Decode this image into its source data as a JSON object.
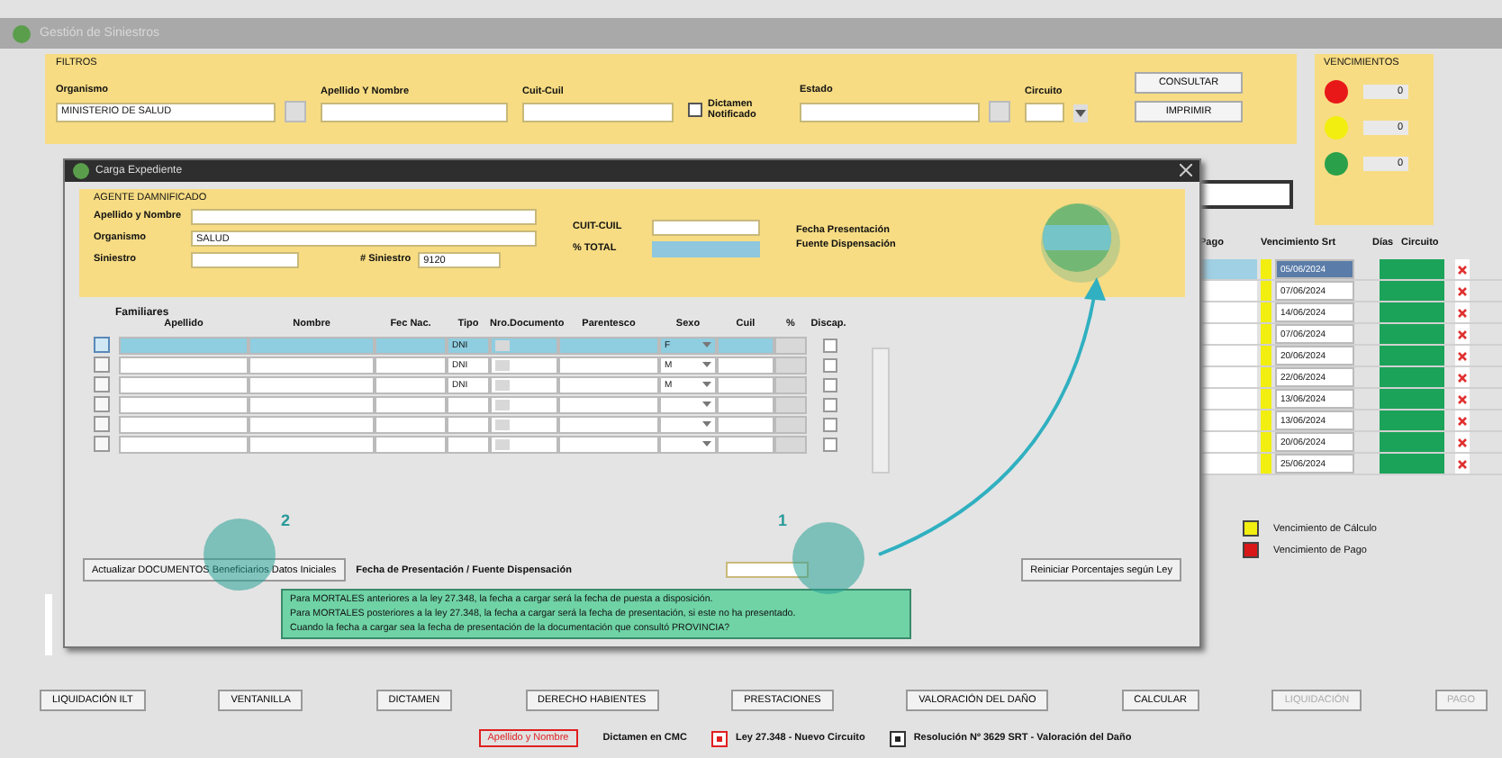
{
  "window": {
    "title": "Gestión de Siniestros"
  },
  "filters": {
    "title": "FILTROS",
    "fields": [
      {
        "label": "Organismo",
        "value": "MINISTERIO DE SALUD",
        "kind": "lookup"
      },
      {
        "label": "Apellido Y Nombre",
        "kind": "text"
      },
      {
        "label": "Cuit-Cuil",
        "kind": "text"
      },
      {
        "label": "Dictamen Notificado",
        "kind": "checkbox",
        "checked": false
      },
      {
        "label": "Estado",
        "kind": "lookup"
      },
      {
        "label": "Circuito",
        "kind": "select"
      }
    ],
    "buttons": [
      "CONSULTAR",
      "IMPRIMIR"
    ]
  },
  "vencimientos": {
    "title": "VENCIMIENTOS",
    "lights": [
      {
        "color": "#e81818",
        "count": "0"
      },
      {
        "color": "#f2ee10",
        "count": "0"
      },
      {
        "color": "#2aa04a",
        "count": "0"
      }
    ]
  },
  "expedientes": {
    "columns": [
      "Pago",
      "Vencimiento Srt",
      "Días",
      "Circuito"
    ],
    "rows": [
      {
        "vencimiento": "05/06/2024",
        "selected": true
      },
      {
        "vencimiento": "07/06/2024",
        "selected": false
      },
      {
        "vencimiento": "14/06/2024",
        "selected": false
      },
      {
        "vencimiento": "07/06/2024",
        "selected": false
      },
      {
        "vencimiento": "20/06/2024",
        "selected": false
      },
      {
        "vencimiento": "22/06/2024",
        "selected": false
      },
      {
        "vencimiento": "13/06/2024",
        "selected": false
      },
      {
        "vencimiento": "13/06/2024",
        "selected": false
      },
      {
        "vencimiento": "20/06/2024",
        "selected": false
      },
      {
        "vencimiento": "25/06/2024",
        "selected": false
      }
    ]
  },
  "legend": [
    {
      "color": "#f2ee10",
      "label": "Vencimiento de Cálculo"
    },
    {
      "color": "#d81818",
      "label": "Vencimiento de Pago"
    }
  ],
  "actions": [
    {
      "label": "LIQUIDACIÓN ILT",
      "disabled": false
    },
    {
      "label": "VENTANILLA",
      "disabled": false
    },
    {
      "label": "DICTAMEN",
      "disabled": false
    },
    {
      "label": "DERECHO HABIENTES",
      "disabled": false
    },
    {
      "label": "PRESTACIONES",
      "disabled": false
    },
    {
      "label": "VALORACIÓN DEL DAÑO",
      "disabled": false
    },
    {
      "label": "CALCULAR",
      "disabled": false
    },
    {
      "label": "LIQUIDACIÓN",
      "disabled": true
    },
    {
      "label": "PAGO",
      "disabled": true
    }
  ],
  "footer": [
    {
      "kind": "tag",
      "label": "Apellido y Nombre"
    },
    {
      "kind": "text",
      "label": "Dictamen en CMC"
    },
    {
      "kind": "checkbox",
      "checked": true,
      "label": "Ley 27.348 - Nuevo Circuito"
    },
    {
      "kind": "checkbox",
      "checked": true,
      "label": "Resolución Nº 3629 SRT - Valoración del Daño"
    }
  ],
  "dialog": {
    "title": "Carga Expediente",
    "group": "AGENTE DAMNIFICADO",
    "apellido_label": "Apellido y Nombre",
    "organismo_label": "Organismo",
    "organismo_value": "SALUD",
    "siniestro_label": "Siniestro",
    "nro_label": "# Siniestro",
    "nro_value": "9120",
    "cuit_label": "CUIT-CUIL",
    "total_label": "% TOTAL",
    "fecha_label": "Fecha Presentación",
    "fuente_label": "Fuente Dispensación",
    "familiares": {
      "title": "Familiares",
      "columns": [
        "Apellido",
        "Nombre",
        "Fec Nac.",
        "Tipo",
        "Nro.Documento",
        "Parentesco",
        "Sexo",
        "Cuil",
        "%",
        "Discap."
      ],
      "rows": [
        {
          "tipo": "DNI",
          "sexo": "F",
          "selected": true,
          "discap": false
        },
        {
          "tipo": "DNI",
          "sexo": "M",
          "selected": false,
          "discap": false
        },
        {
          "tipo": "DNI",
          "sexo": "M",
          "selected": false,
          "discap": false
        },
        {
          "selected": false,
          "discap": false
        },
        {
          "selected": false,
          "discap": false
        },
        {
          "selected": false,
          "discap": false
        }
      ]
    },
    "update_button": "Actualizar DOCUMENTOS Beneficiarios Datos Iniciales",
    "fecha_bar_label": "Fecha de Presentación / Fuente Dispensación",
    "reset_button": "Reiniciar Porcentajes según Ley",
    "tooltip": [
      "Para MORTALES anteriores a la ley 27.348, la fecha a cargar será la fecha de puesta a disposición.",
      "Para MORTALES posteriores a la ley 27.348, la fecha a cargar será la fecha de presentación, si este no ha presentado.",
      "Cuando la fecha a cargar sea la fecha de presentación de la documentación que consultó PROVINCIA?"
    ]
  },
  "callouts": [
    "2",
    "1"
  ]
}
